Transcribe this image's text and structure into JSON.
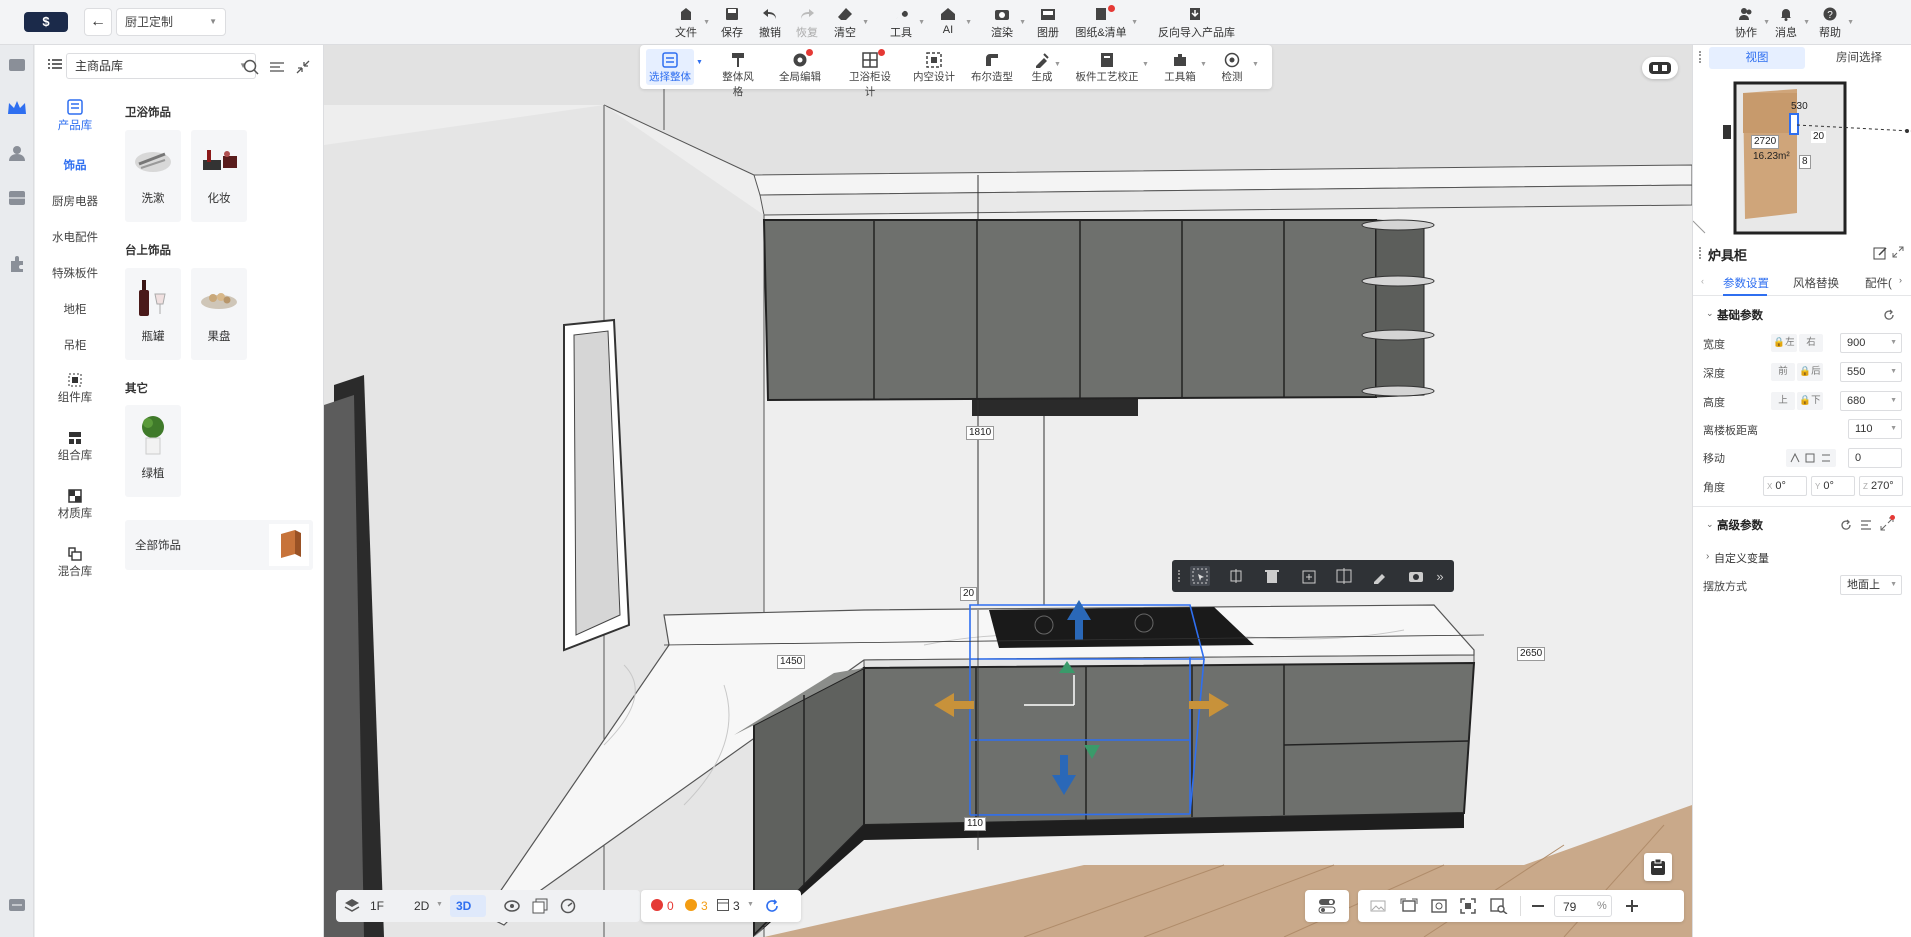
{
  "header": {
    "logo": "$",
    "project_name": "厨卫定制",
    "tools": [
      {
        "label": "文件"
      },
      {
        "label": "保存"
      },
      {
        "label": "撤销"
      },
      {
        "label": "恢复"
      },
      {
        "label": "清空"
      },
      {
        "label": "工具"
      },
      {
        "label": "AI"
      },
      {
        "label": "渲染"
      },
      {
        "label": "图册"
      },
      {
        "label": "图纸&清单"
      },
      {
        "label": "反向导入产品库"
      }
    ],
    "right": [
      {
        "label": "协作"
      },
      {
        "label": "消息"
      },
      {
        "label": "帮助"
      }
    ]
  },
  "panel": {
    "library": "主商品库",
    "categories": [
      {
        "label": "产品库"
      },
      {
        "label": "饰品"
      },
      {
        "label": "厨房电器"
      },
      {
        "label": "水电配件"
      },
      {
        "label": "特殊板件"
      },
      {
        "label": "地柜"
      },
      {
        "label": "吊柜"
      },
      {
        "label": "组件库"
      },
      {
        "label": "组合库"
      },
      {
        "label": "材质库"
      },
      {
        "label": "混合库"
      }
    ],
    "sections": [
      {
        "title": "卫浴饰品",
        "items": [
          "洗漱",
          "化妆"
        ]
      },
      {
        "title": "台上饰品",
        "items": [
          "瓶罐",
          "果盘"
        ]
      },
      {
        "title": "其它",
        "items": [
          "绿植"
        ]
      }
    ],
    "all_label": "全部饰品"
  },
  "canvas_toolbar": [
    {
      "label": "选择整体"
    },
    {
      "label": "整体风格"
    },
    {
      "label": "全局编辑"
    },
    {
      "label": "卫浴柜设计"
    },
    {
      "label": "内空设计"
    },
    {
      "label": "布尔造型"
    },
    {
      "label": "生成"
    },
    {
      "label": "板件工艺校正"
    },
    {
      "label": "工具箱"
    },
    {
      "label": "检测"
    }
  ],
  "dimensions": {
    "d1810": "1810",
    "d20": "20",
    "d1450": "1450",
    "d2650": "2650",
    "d110": "110"
  },
  "bottom": {
    "floor": "1F",
    "mode2d": "2D",
    "mode3d": "3D",
    "errors": "0",
    "warnings": "3",
    "info": "3",
    "zoom": "79",
    "zoom_unit": "%"
  },
  "minimap": {
    "tabs": [
      "视图",
      "房间选择"
    ],
    "dim_530": "530",
    "dim_2720": "2720",
    "dim_20": "20",
    "dim_8": "8",
    "area": "16.23m²"
  },
  "props": {
    "title": "炉具柜",
    "tabs": [
      "参数设置",
      "风格替换",
      "配件("
    ],
    "basic_title": "基础参数",
    "rows": [
      {
        "label": "宽度",
        "a": "左",
        "b": "右",
        "value": "900"
      },
      {
        "label": "深度",
        "a": "前",
        "b": "后",
        "value": "550"
      },
      {
        "label": "高度",
        "a": "上",
        "b": "下",
        "value": "680"
      }
    ],
    "floor_label": "离楼板距离",
    "floor_value": "110",
    "move_label": "移动",
    "move_value": "0",
    "angle_label": "角度",
    "angle_x_label": "X",
    "angle_x": "0°",
    "angle_y_label": "Y",
    "angle_y": "0°",
    "angle_z_label": "Z",
    "angle_z": "270°",
    "adv_title": "高级参数",
    "custom_var": "自定义变量",
    "placement_label": "摆放方式",
    "placement_value": "地面上"
  },
  "colors": {
    "accent": "#2f6ff0",
    "cabinet": "#6e706d",
    "alert": "#e53935"
  }
}
